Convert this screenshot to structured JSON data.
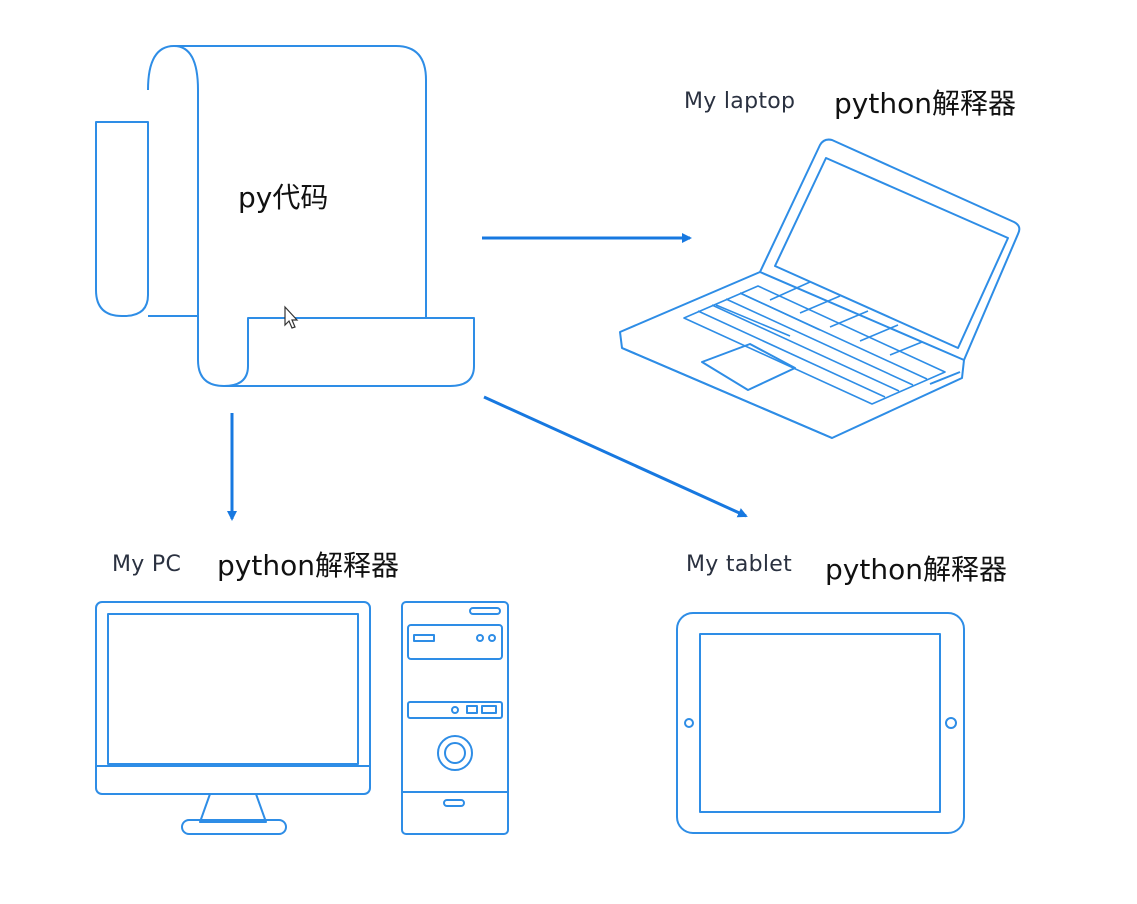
{
  "code_label": "py代码",
  "devices": {
    "laptop": {
      "name": "My laptop",
      "interpreter": "python解释器"
    },
    "pc": {
      "name": "My PC",
      "interpreter": "python解释器"
    },
    "tablet": {
      "name": "My tablet",
      "interpreter": "python解释器"
    }
  },
  "colors": {
    "stroke": "#2e8de6",
    "arrow": "#1778e0",
    "text": "#111111"
  },
  "icons": [
    "scroll-icon",
    "laptop-icon",
    "pc-monitor-icon",
    "pc-tower-icon",
    "tablet-icon",
    "mouse-cursor-icon"
  ]
}
